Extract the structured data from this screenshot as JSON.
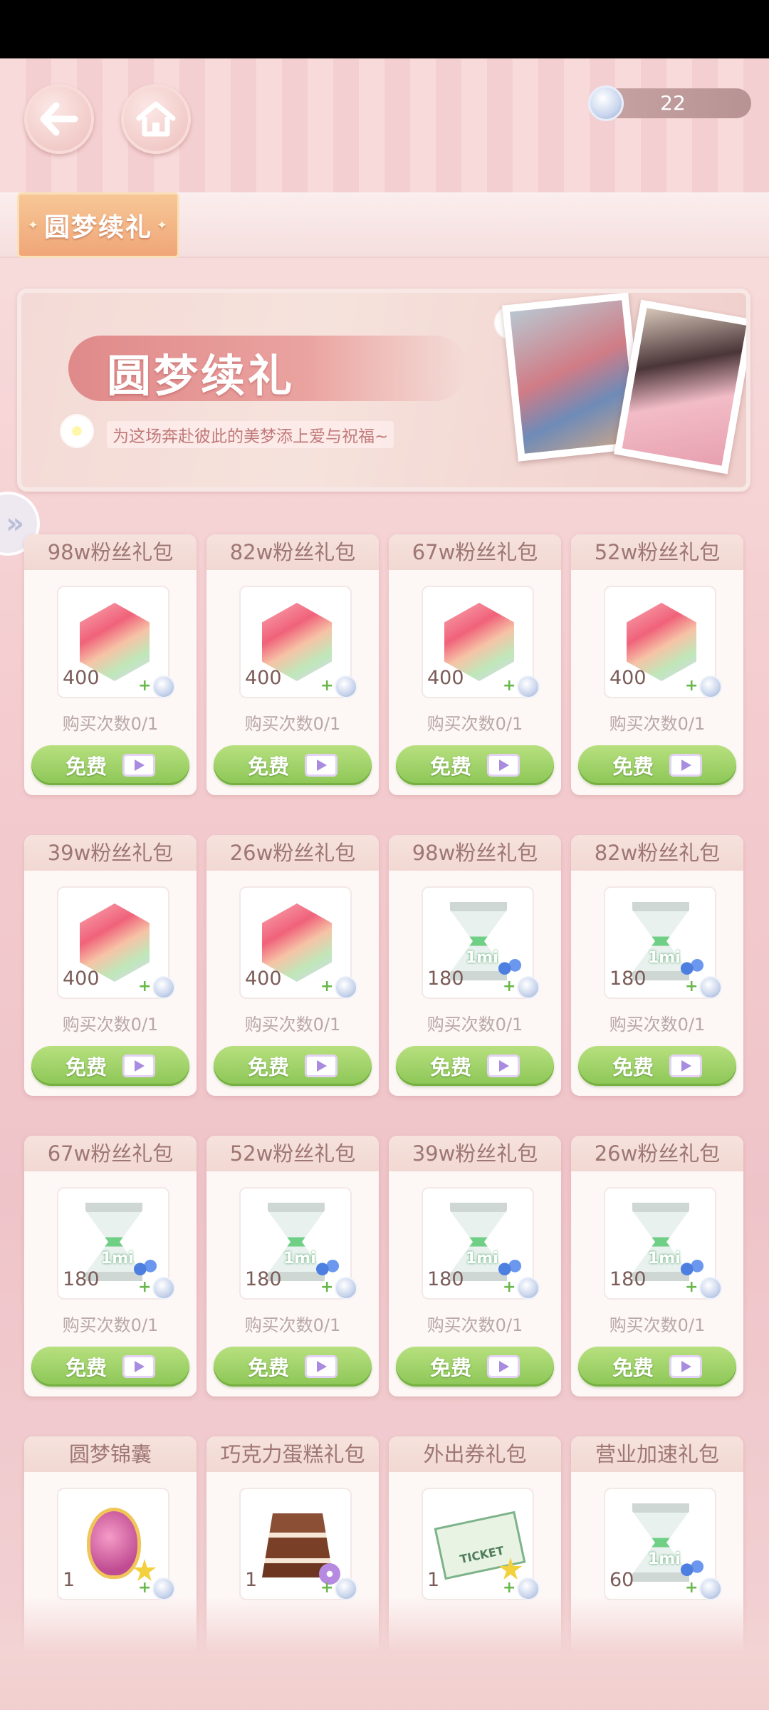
{
  "currency": {
    "value": "22"
  },
  "tabs": [
    {
      "label": "圆梦续礼",
      "active": true
    }
  ],
  "banner": {
    "title": "圆梦续礼",
    "subtitle": "为这场奔赴彼此的美梦添上爱与祝福~"
  },
  "cards": [
    {
      "title": "98w粉丝礼包",
      "icon": "gem-icon",
      "qty": "400",
      "limit": "购买次数0/1",
      "button": "免费"
    },
    {
      "title": "82w粉丝礼包",
      "icon": "gem-icon",
      "qty": "400",
      "limit": "购买次数0/1",
      "button": "免费"
    },
    {
      "title": "67w粉丝礼包",
      "icon": "gem-icon",
      "qty": "400",
      "limit": "购买次数0/1",
      "button": "免费"
    },
    {
      "title": "52w粉丝礼包",
      "icon": "gem-icon",
      "qty": "400",
      "limit": "购买次数0/1",
      "button": "免费"
    },
    {
      "title": "39w粉丝礼包",
      "icon": "gem-icon",
      "qty": "400",
      "limit": "购买次数0/1",
      "button": "免费"
    },
    {
      "title": "26w粉丝礼包",
      "icon": "gem-icon",
      "qty": "400",
      "limit": "购买次数0/1",
      "button": "免费"
    },
    {
      "title": "98w粉丝礼包",
      "icon": "hourglass-icon",
      "qty": "180",
      "limit": "购买次数0/1",
      "button": "免费"
    },
    {
      "title": "82w粉丝礼包",
      "icon": "hourglass-icon",
      "qty": "180",
      "limit": "购买次数0/1",
      "button": "免费"
    },
    {
      "title": "67w粉丝礼包",
      "icon": "hourglass-icon",
      "qty": "180",
      "limit": "购买次数0/1",
      "button": "免费"
    },
    {
      "title": "52w粉丝礼包",
      "icon": "hourglass-icon",
      "qty": "180",
      "limit": "购买次数0/1",
      "button": "免费"
    },
    {
      "title": "39w粉丝礼包",
      "icon": "hourglass-icon",
      "qty": "180",
      "limit": "购买次数0/1",
      "button": "免费"
    },
    {
      "title": "26w粉丝礼包",
      "icon": "hourglass-icon",
      "qty": "180",
      "limit": "购买次数0/1",
      "button": "免费"
    },
    {
      "title": "圆梦锦囊",
      "icon": "lucky-bag-icon",
      "qty": "1"
    },
    {
      "title": "巧克力蛋糕礼包",
      "icon": "chocolate-cake-icon",
      "qty": "1"
    },
    {
      "title": "外出券礼包",
      "icon": "ticket-icon",
      "qty": "1",
      "ticket_text": "TICKET"
    },
    {
      "title": "营业加速礼包",
      "icon": "hourglass-icon",
      "qty": "60"
    }
  ],
  "hourglass_label": "1mi",
  "colors": {
    "free_button": "#8cc656",
    "tab_active": "#f0a678",
    "card_header": "#f2d8d2"
  }
}
